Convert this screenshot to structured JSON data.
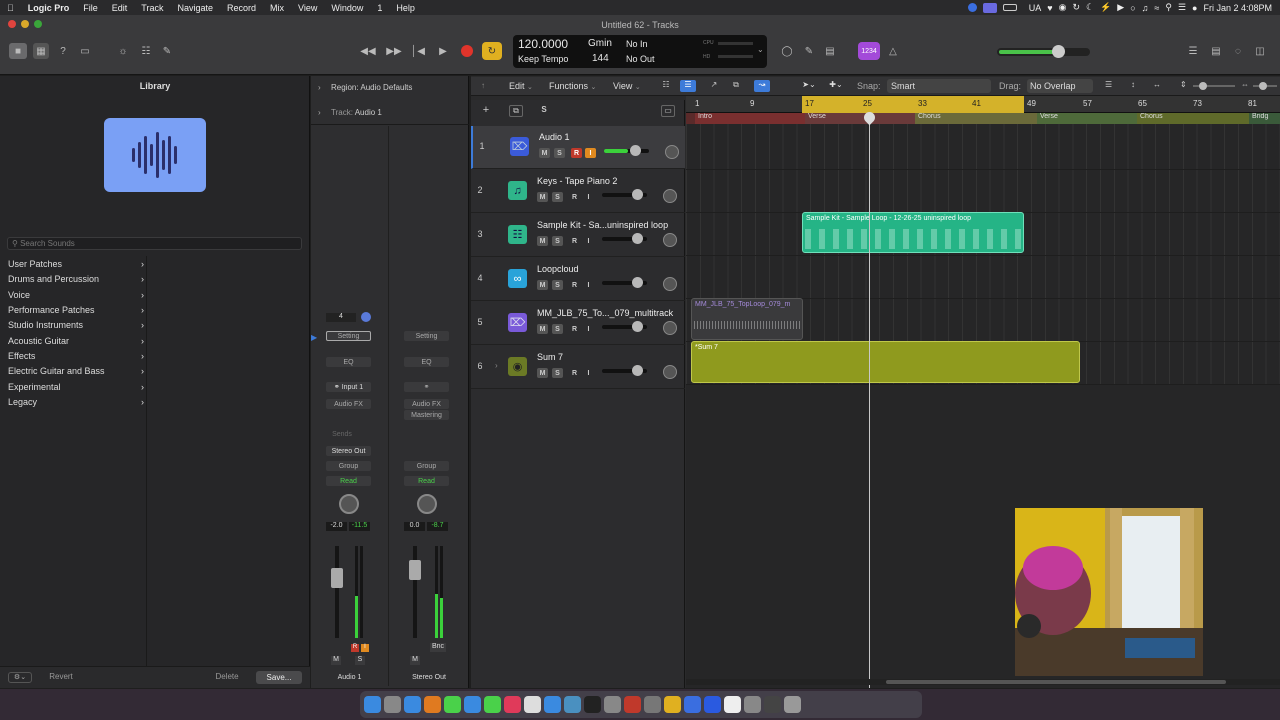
{
  "menubar": {
    "app": "Logic Pro",
    "items": [
      "File",
      "Edit",
      "Track",
      "Navigate",
      "Record",
      "Mix",
      "View",
      "Window",
      "1",
      "Help"
    ],
    "status": {
      "lang": "UA",
      "datetime": "Fri Jan 2  4:08PM"
    }
  },
  "window": {
    "title": "Untitled 62 - Tracks"
  },
  "lcd": {
    "tempo": "120.0000",
    "key": "Gmin",
    "input": "No In",
    "tempo_mode": "Keep Tempo",
    "bpm_sub": "144",
    "output": "No Out",
    "cpu_label": "CPU",
    "hd_label": "HD"
  },
  "badge": "1234",
  "library": {
    "title": "Library",
    "search_placeholder": "Search Sounds",
    "items": [
      "User Patches",
      "Drums and Percussion",
      "Voice",
      "Performance Patches",
      "Studio Instruments",
      "Acoustic Guitar",
      "Effects",
      "Electric Guitar and Bass",
      "Experimental",
      "Legacy"
    ],
    "revert": "Revert",
    "delete": "Delete",
    "save": "Save..."
  },
  "inspector": {
    "region_label": "Region:",
    "region_value": "Audio Defaults",
    "track_label": "Track:",
    "track_value": "Audio 1",
    "strip1": {
      "input_num": "4",
      "setting": "Setting",
      "eq": "EQ",
      "input": "Input 1",
      "fx": "Audio FX",
      "sends": "Sends",
      "output": "Stereo Out",
      "group": "Group",
      "automation": "Read",
      "vol": "-2.0",
      "peak": "-11.5",
      "r": "R",
      "i": "I",
      "m": "M",
      "s": "S",
      "name": "Audio 1"
    },
    "strip2": {
      "setting": "Setting",
      "eq": "EQ",
      "fx": "Audio FX",
      "fx2": "Mastering",
      "group": "Group",
      "automation": "Read",
      "vol": "0.0",
      "peak": "-8.7",
      "m": "M",
      "bnc": "Bnc",
      "name": "Stereo Out"
    }
  },
  "toolbar": {
    "edit": "Edit",
    "functions": "Functions",
    "view": "View",
    "snap_label": "Snap:",
    "snap_value": "Smart",
    "drag_label": "Drag:",
    "drag_value": "No Overlap"
  },
  "track_header_tools": {
    "add": "+",
    "s": "S"
  },
  "tracks": [
    {
      "num": "1",
      "name": "Audio 1",
      "color": "#3b5bd9",
      "icon": "waveform"
    },
    {
      "num": "2",
      "name": "Keys - Tape Piano 2",
      "color": "#2fb58a",
      "icon": "music-note"
    },
    {
      "num": "3",
      "name": "Sample Kit - Sa...uninspired loop",
      "color": "#2fb58a",
      "icon": "grid"
    },
    {
      "num": "4",
      "name": "Loopcloud",
      "color": "#29a3d9",
      "icon": "loop"
    },
    {
      "num": "5",
      "name": "MM_JLB_75_To..._079_multitrack",
      "color": "#7a5ad9",
      "icon": "waveform"
    },
    {
      "num": "6",
      "name": "Sum 7",
      "color": "#6b7a25",
      "icon": "stack"
    }
  ],
  "msri": {
    "m": "M",
    "s": "S",
    "r": "R",
    "i": "I"
  },
  "ruler": [
    "1",
    "9",
    "17",
    "25",
    "33",
    "41",
    "49",
    "57",
    "65",
    "73",
    "81"
  ],
  "arrangement_markers": [
    {
      "label": "Intro",
      "color": "#7a2f2f"
    },
    {
      "label": "Verse",
      "color": "#6a3a3a"
    },
    {
      "label": "Chorus",
      "color": "#6b6a3a"
    },
    {
      "label": "Verse",
      "color": "#4e6a3a"
    },
    {
      "label": "Chorus",
      "color": "#5f6a2a"
    },
    {
      "label": "Bridg",
      "color": "#3a5a3a"
    }
  ],
  "regions": {
    "sample_kit": "Sample Kit - Sample Loop - 12-26-25 uninspired loop",
    "multitrack": "MM_JLB_75_TopLoop_079_m",
    "sum": "*Sum 7"
  },
  "colors": {
    "accent": "#3d7bd9",
    "record": "#e0342b",
    "cycle": "#e0b020",
    "region_green": "#25b486",
    "region_olive": "#8f9a1e",
    "marker_bg": "#5a2a2a"
  }
}
